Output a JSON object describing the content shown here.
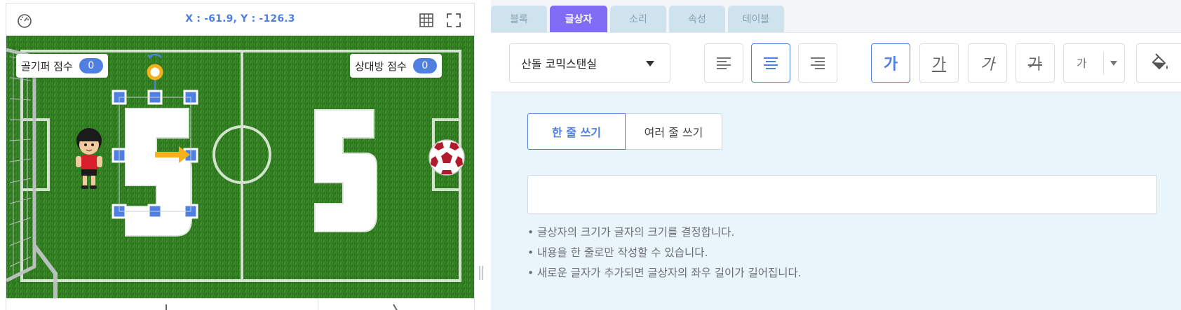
{
  "stage": {
    "coords": "X : -61.9,  Y : -126.3",
    "icons": {
      "speed": "speed-gauge-icon",
      "grid": "grid-icon",
      "fullscreen": "fullscreen-icon"
    },
    "score_goalkeeper": {
      "label": "골기퍼 점수",
      "value": "0"
    },
    "score_opponent": {
      "label": "상대방 점수",
      "value": "0"
    },
    "scoreboard_left_digit": "5",
    "scoreboard_right_digit": "5"
  },
  "editor": {
    "tabs": [
      {
        "label": "블록"
      },
      {
        "label": "글상자"
      },
      {
        "label": "소리"
      },
      {
        "label": "속성"
      },
      {
        "label": "테이블"
      }
    ],
    "active_tab": "글상자",
    "toolbar": {
      "font_name": "산돌 코믹스탠실",
      "align_icons": [
        "align-left-icon",
        "align-center-icon",
        "align-right-icon"
      ],
      "style_buttons": [
        {
          "label": "가",
          "style": "bold"
        },
        {
          "label": "가",
          "style": "underline"
        },
        {
          "label": "가",
          "style": "italic"
        },
        {
          "label": "가",
          "style": "strikethrough"
        }
      ],
      "font_size_label": "가",
      "fill_icon": "paint-bucket-icon"
    },
    "modes": {
      "single": "한 줄 쓰기",
      "multi": "여러 줄 쓰기"
    },
    "text_value": "",
    "notes": [
      "글상자의 크기가 글자의 크기를 결정합니다.",
      "내용을 한 줄로만 작성할 수 있습니다.",
      "새로운 글자가 추가되면 글상자의 좌우 길이가 길어집니다."
    ]
  },
  "colors": {
    "accent": "#4f80e1",
    "tab_active": "#7e6cf4",
    "tab_inactive": "#cfe3ef",
    "field_green": "#2f7a20",
    "content_bg": "#e9f4fb"
  }
}
